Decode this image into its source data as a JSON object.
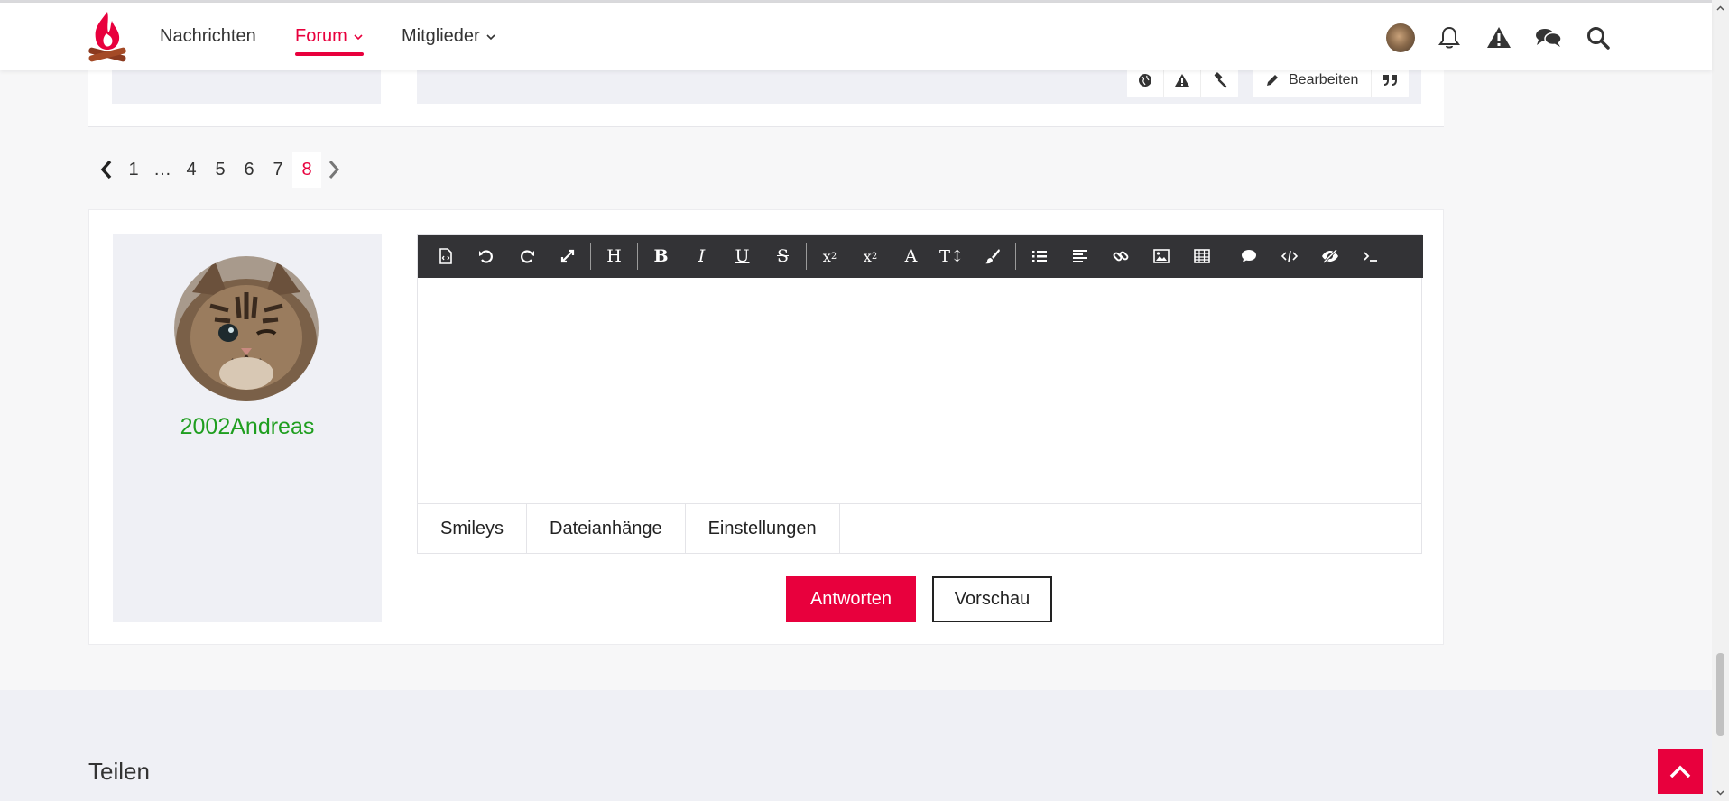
{
  "header": {
    "nav": [
      {
        "label": "Nachrichten"
      },
      {
        "label": "Forum",
        "active": true
      },
      {
        "label": "Mitglieder"
      }
    ],
    "icons": [
      "avatar",
      "bell-icon",
      "warning-icon",
      "chat-icon",
      "search-icon"
    ]
  },
  "previous_post": {
    "actions": [
      "globe-icon",
      "warning-icon",
      "gavel-icon"
    ],
    "edit_label": "Bearbeiten",
    "quote_icon": "quote-icon"
  },
  "pagination": {
    "pages": [
      "1",
      "…",
      "4",
      "5",
      "6",
      "7",
      "8"
    ],
    "current": "8"
  },
  "reply": {
    "username": "2002Andreas",
    "toolbar_icons": [
      "source-icon",
      "undo-icon",
      "redo-icon",
      "fullscreen-icon",
      "heading-icon",
      "bold-icon",
      "italic-icon",
      "underline-icon",
      "strikethrough-icon",
      "subscript-icon",
      "superscript-icon",
      "font-icon",
      "font-size-icon",
      "paint-icon",
      "list-icon",
      "align-icon",
      "link-icon",
      "image-icon",
      "table-icon",
      "comment-icon",
      "code-icon",
      "spoiler-icon",
      "inline-code-icon"
    ],
    "tabs": [
      "Smileys",
      "Dateianhänge",
      "Einstellungen"
    ],
    "submit_label": "Antworten",
    "preview_label": "Vorschau"
  },
  "footer": {
    "share_title": "Teilen"
  },
  "colors": {
    "accent": "#e8003d",
    "username": "#1f9e1f",
    "toolbar_bg": "#333336",
    "panel_bg": "#eff0f5"
  }
}
